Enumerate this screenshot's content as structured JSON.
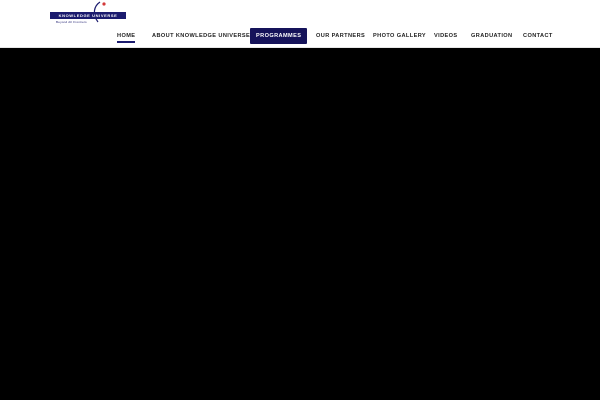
{
  "brand": {
    "name": "KNOWLEDGE UNIVERSE",
    "tagline": "Beyond All Frontiers",
    "accent_color": "#1b1b6e",
    "highlight_color": "#15135a"
  },
  "nav": {
    "items": [
      {
        "label": "HOME",
        "state": "active"
      },
      {
        "label": "ABOUT KNOWLEDGE UNIVERSE",
        "state": "normal"
      },
      {
        "label": "PROGRAMMES",
        "state": "highlighted"
      },
      {
        "label": "OUR PARTNERS",
        "state": "normal"
      },
      {
        "label": "PHOTO GALLERY",
        "state": "normal"
      },
      {
        "label": "VIDEOS",
        "state": "normal"
      },
      {
        "label": "GRADUATION",
        "state": "normal"
      },
      {
        "label": "CONTACT",
        "state": "normal"
      }
    ]
  },
  "hero": {
    "background_color": "#000000"
  }
}
